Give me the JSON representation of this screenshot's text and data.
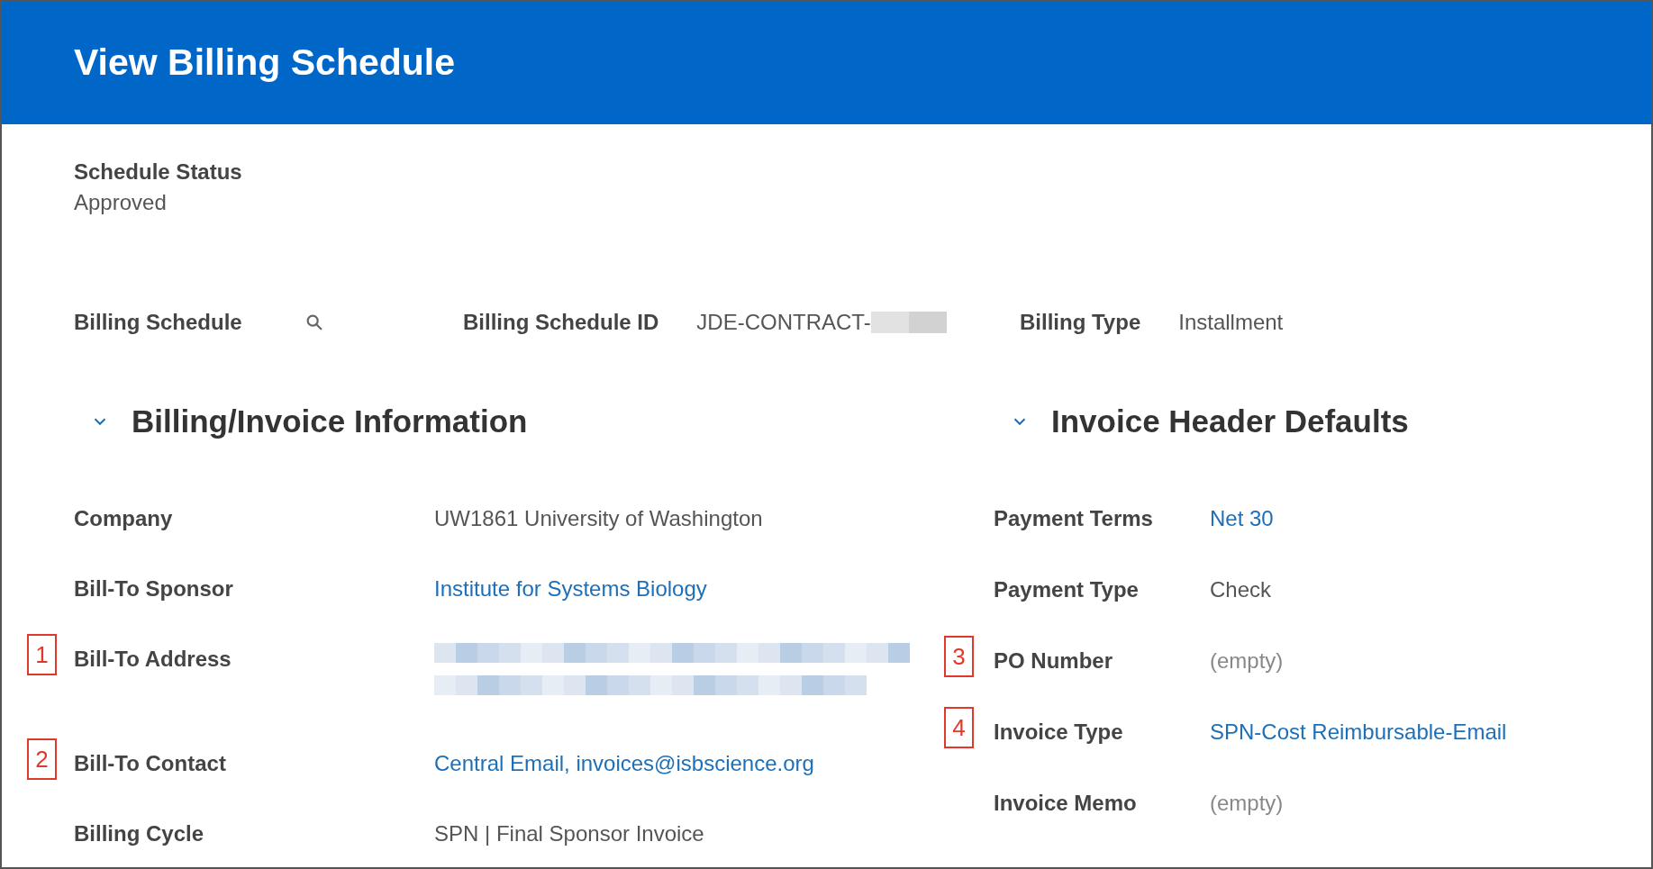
{
  "header": {
    "title": "View Billing Schedule"
  },
  "status": {
    "label": "Schedule Status",
    "value": "Approved"
  },
  "summary": [
    {
      "label": "Billing Schedule",
      "kind": "search"
    },
    {
      "label": "Billing Schedule ID",
      "value": "JDE-CONTRACT-",
      "kind": "redacted"
    },
    {
      "label": "Billing Type",
      "value": "Installment",
      "kind": "text"
    }
  ],
  "sections": [
    {
      "title": "Billing/Invoice Information",
      "expanded": true,
      "rows": [
        {
          "label": "Company",
          "value": "UW1861 University of Washington",
          "kind": "text"
        },
        {
          "label": "Bill-To Sponsor",
          "value": "Institute for Systems Biology",
          "kind": "link"
        },
        {
          "label": "Bill-To Address",
          "kind": "redacted",
          "marker": "1"
        },
        {
          "label": "Bill-To Contact",
          "value": "Central Email, invoices@isbscience.org",
          "kind": "link",
          "marker": "2"
        },
        {
          "label": "Billing Cycle",
          "value": "SPN | Final Sponsor Invoice",
          "kind": "text"
        }
      ]
    },
    {
      "title": "Invoice Header Defaults",
      "expanded": true,
      "rows": [
        {
          "label": "Payment Terms",
          "value": "Net 30",
          "kind": "link"
        },
        {
          "label": "Payment Type",
          "value": "Check",
          "kind": "text"
        },
        {
          "label": "PO Number",
          "value": "(empty)",
          "kind": "empty",
          "marker": "3"
        },
        {
          "label": "Invoice Type",
          "value": "SPN-Cost Reimbursable-Email",
          "kind": "link",
          "marker": "4"
        },
        {
          "label": "Invoice Memo",
          "value": "(empty)",
          "kind": "empty"
        }
      ]
    }
  ]
}
